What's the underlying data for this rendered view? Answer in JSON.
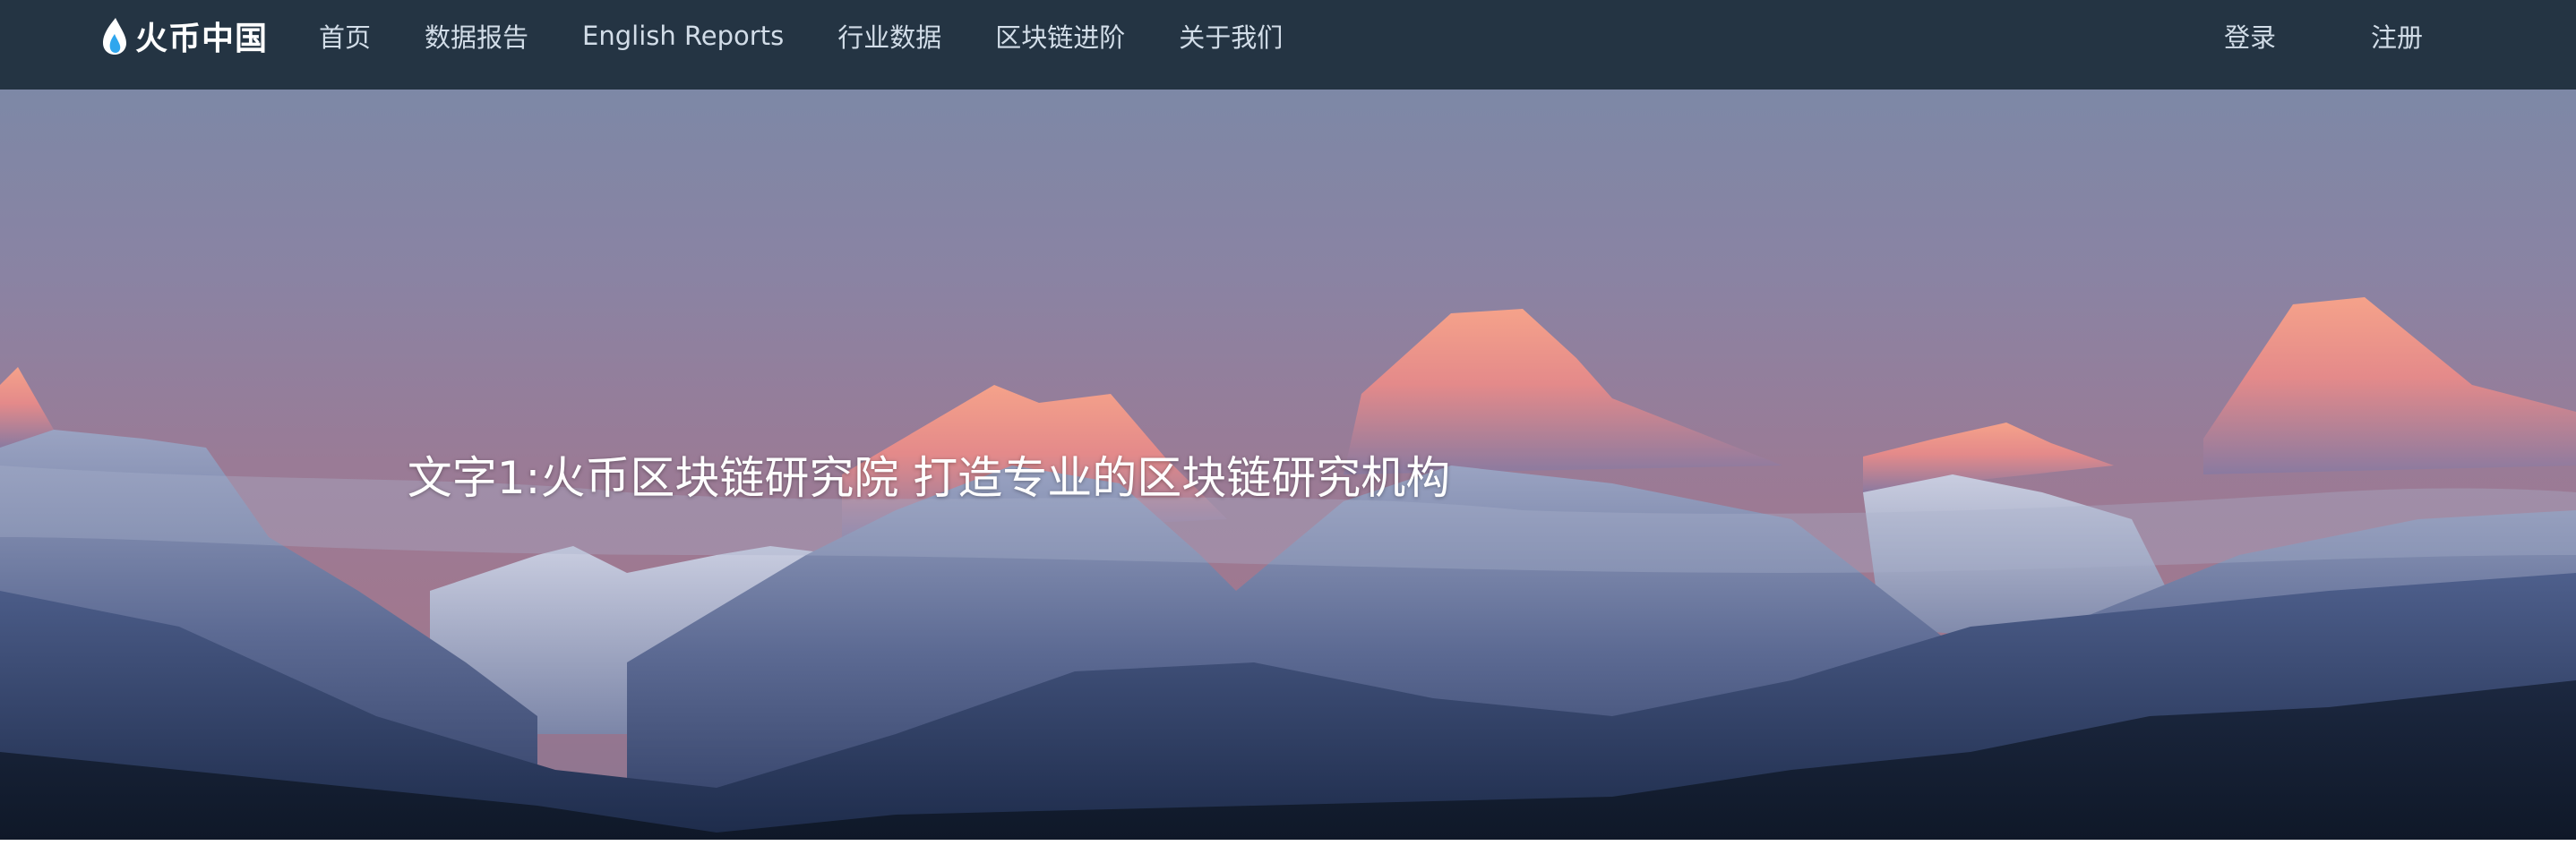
{
  "brand": {
    "logo_text": "火币中国",
    "logo_icon": "flame-icon"
  },
  "nav": {
    "items": [
      {
        "label": "首页"
      },
      {
        "label": "数据报告"
      },
      {
        "label": "English Reports"
      },
      {
        "label": "行业数据"
      },
      {
        "label": "区块链进阶"
      },
      {
        "label": "关于我们"
      }
    ]
  },
  "auth": {
    "login_label": "登录",
    "register_label": "注册"
  },
  "hero": {
    "caption": "文字1:火币区块链研究院 打造专业的区块链研究机构",
    "image": "mountain-sunset-banner"
  },
  "colors": {
    "topbar_bg": "#243443",
    "nav_text": "#d2dde8",
    "caption_text": "#ffffff"
  }
}
